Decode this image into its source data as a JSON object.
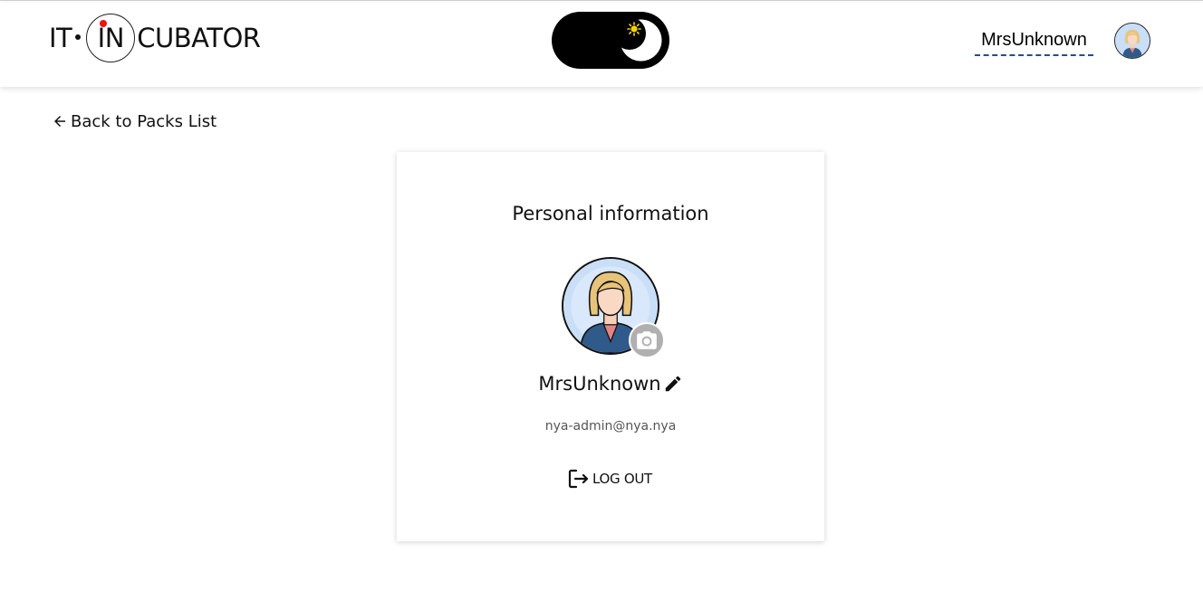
{
  "header": {
    "logo": {
      "left": "IT",
      "in": "IN",
      "right": "CUBATOR"
    },
    "theme_toggle": {
      "state": "dark",
      "icon": "moon-sun-icon"
    },
    "user_name": "MrsUnknown",
    "avatar_icon": "user-avatar-icon"
  },
  "nav": {
    "back_label": "Back to Packs List",
    "back_icon": "arrow-left-icon"
  },
  "profile": {
    "title": "Personal information",
    "avatar_icon": "profile-avatar-icon",
    "camera_icon": "camera-icon",
    "name": "MrsUnknown",
    "edit_icon": "pencil-icon",
    "email": "nya-admin@nya.nya",
    "logout_label": "LOG OUT",
    "logout_icon": "logout-icon"
  },
  "colors": {
    "toggle_bg": "#000000",
    "underline": "#2a4d80",
    "camera_bg": "#b0b0b0",
    "logo_dot_red": "#ee1111"
  }
}
